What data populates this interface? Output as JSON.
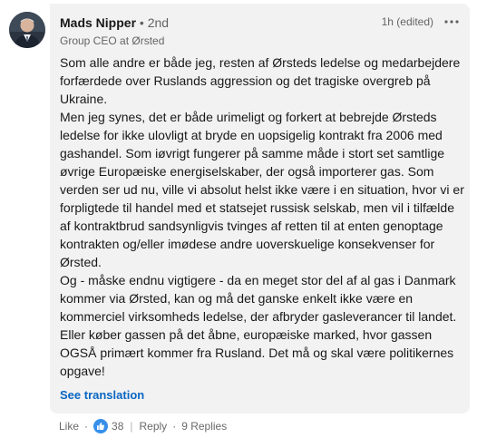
{
  "comment": {
    "author": {
      "name": "Mads Nipper",
      "bullet": "•",
      "degree": "2nd",
      "headline": "Group CEO at Ørsted"
    },
    "meta": {
      "time": "1h (edited)",
      "more_icon": "ellipsis-icon"
    },
    "paragraphs": [
      "Som alle andre er både jeg, resten af Ørsteds ledelse og medarbejdere forfærdede over Ruslands aggression og det tragiske overgreb på Ukraine.",
      "Men jeg synes, det er både urimeligt og forkert at bebrejde Ørsteds ledelse for ikke ulovligt at bryde en uopsigelig kontrakt fra 2006 med gashandel. Som iøvrigt fungerer på samme måde i stort set samtlige øvrige Europæiske energiselskaber, der også importerer gas. Som verden ser ud nu, ville vi absolut helst ikke være i en situation, hvor vi er forpligtede til handel med et statsejet russisk selskab, men vil i tilfælde af kontraktbrud sandsynligvis tvinges af retten til at enten genoptage kontrakten og/eller imødese andre uoverskuelige konsekvenser for Ørsted.",
      "Og - måske endnu vigtigere - da en meget stor del af al gas i Danmark kommer via Ørsted, kan og må det ganske enkelt ikke være en kommerciel virksomheds ledelse, der afbryder gasleverancer til landet. Eller køber gassen på det åbne, europæiske marked, hvor gassen OGSÅ primært kommer fra Rusland. Det må og skal være politikernes opgave!"
    ],
    "see_translation": "See translation"
  },
  "actions": {
    "like_label": "Like",
    "dot": "·",
    "reaction_icon": "thumbs-up-icon",
    "reaction_count": "38",
    "divider": "|",
    "reply_label": "Reply",
    "replies_count": "9 Replies"
  },
  "colors": {
    "bubble": "#f2f2f2",
    "link": "#0a66c2",
    "reaction": "#378fe9"
  }
}
